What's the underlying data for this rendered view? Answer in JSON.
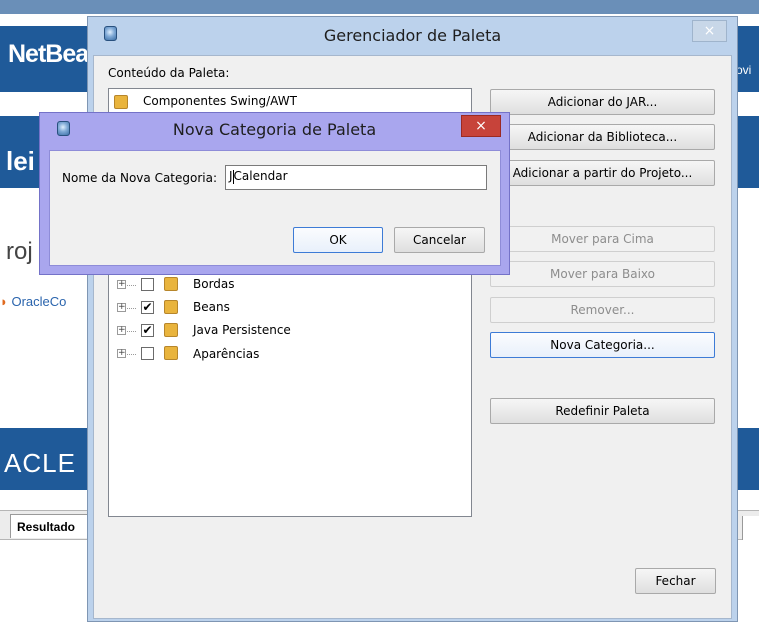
{
  "background": {
    "logo_text": "NetBea",
    "right_text": "ovi",
    "band2_text": "lei",
    "projects_text": "roj",
    "oracle_link": "OracleCo",
    "oracle_logo_text": "ACLE",
    "result_tab": "Resultado"
  },
  "main_dialog": {
    "title": "Gerenciador de Paleta",
    "close_label": "×",
    "content_label": "Conteúdo da Paleta:",
    "tree": [
      {
        "label": "Componentes Swing/AWT",
        "checked": null,
        "expandable": false
      },
      {
        "label": "Bordas",
        "checked": false,
        "expandable": true
      },
      {
        "label": "Beans",
        "checked": true,
        "expandable": true
      },
      {
        "label": "Java Persistence",
        "checked": true,
        "expandable": true
      },
      {
        "label": "Aparências",
        "checked": false,
        "expandable": true
      }
    ],
    "buttons": {
      "add_jar": "Adicionar do JAR...",
      "add_library": "Adicionar da Biblioteca...",
      "add_project": "Adicionar a partir do Projeto...",
      "move_up": "Mover para Cima",
      "move_down": "Mover para Baixo",
      "remove": "Remover...",
      "new_category": "Nova Categoria...",
      "reset_palette": "Redefinir Paleta",
      "close": "Fechar"
    }
  },
  "sub_dialog": {
    "title": "Nova Categoria de Paleta",
    "close_label": "×",
    "field_label": "Nome da Nova Categoria:",
    "field_value_before_caret": "J",
    "field_value_after_caret": "Calendar",
    "ok": "OK",
    "cancel": "Cancelar"
  },
  "colors": {
    "netbeans_blue": "#1f5a99",
    "dialog_frame": "#bcd2ec",
    "subdialog_frame": "#a9a6ee",
    "close_red": "#c7433a"
  },
  "icons": {
    "app": "netbeans-cube-icon",
    "folder": "folder-icon",
    "close": "close-icon",
    "expand": "plus-expander-icon",
    "check": "checkbox-icon"
  }
}
